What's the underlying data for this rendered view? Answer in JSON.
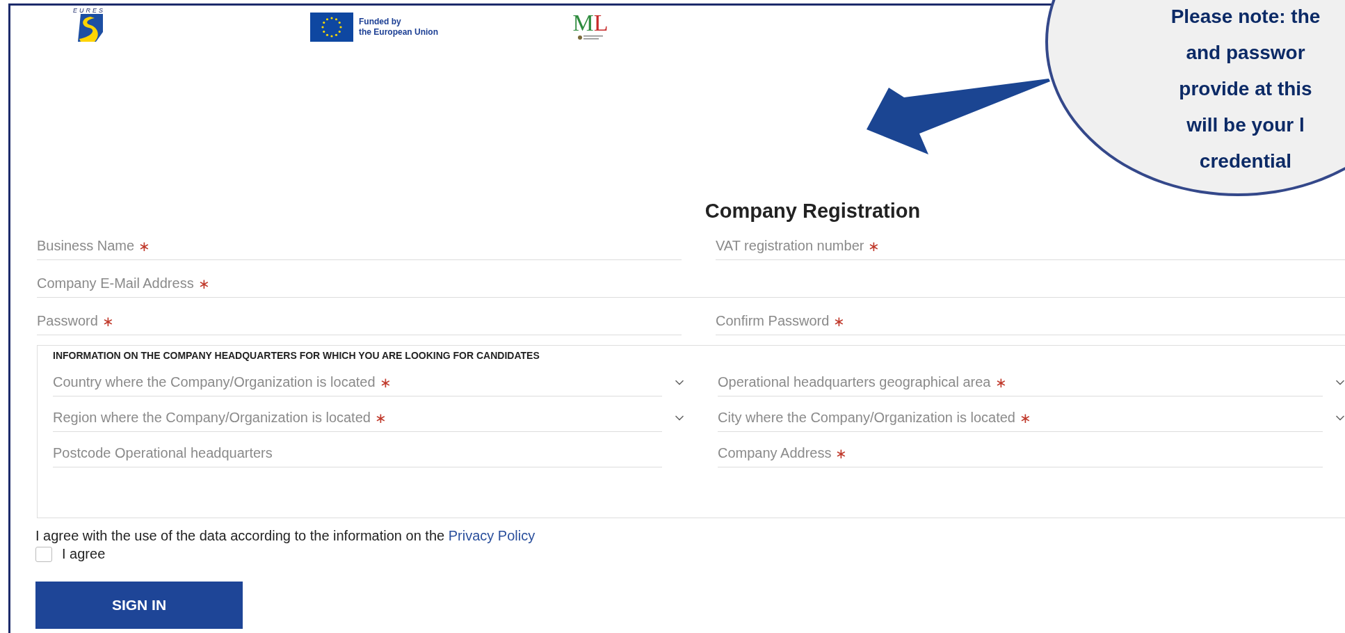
{
  "header": {
    "eures": {
      "wordmark": "EURES"
    },
    "funding": {
      "lines": [
        "Funded by",
        "the European Union"
      ]
    },
    "ministry": {
      "letters": [
        {
          "char": "M",
          "color": "#2e8b3e"
        },
        {
          "char": "L",
          "color": "#c62828"
        }
      ]
    }
  },
  "callout": {
    "lines": [
      "Please note: the",
      "and passwor",
      "provide at this",
      "will be your l",
      "credential"
    ]
  },
  "title": "Company Registration",
  "required_mark": "∗",
  "account_rows": [
    [
      {
        "label": "Business Name",
        "required": true
      },
      {
        "label": "VAT registration number",
        "required": true
      }
    ],
    [
      {
        "label": "Company E-Mail Address",
        "required": true
      }
    ],
    [
      {
        "label": "Password",
        "required": true
      },
      {
        "label": "Confirm Password",
        "required": true
      }
    ]
  ],
  "headquarters": {
    "legend": "INFORMATION ON THE COMPANY HEADQUARTERS FOR WHICH YOU ARE LOOKING FOR CANDIDATES",
    "rows": [
      [
        {
          "kind": "dropdown",
          "label": "Country where the Company/Organization is located",
          "required": true
        },
        {
          "kind": "dropdown",
          "label": "Operational headquarters geographical area",
          "required": true
        }
      ],
      [
        {
          "kind": "dropdown",
          "label": "Region where the Company/Organization is located",
          "required": true
        },
        {
          "kind": "dropdown",
          "label": "City where the Company/Organization is located",
          "required": true
        }
      ],
      [
        {
          "kind": "text",
          "label": "Postcode Operational headquarters",
          "required": false
        },
        {
          "kind": "text",
          "label": "Company Address",
          "required": true
        }
      ]
    ]
  },
  "consent": {
    "text": "I agree with the use of the data according to the information on the",
    "link": "Privacy Policy",
    "checkbox": {
      "label": "I agree",
      "checked": false
    }
  },
  "submit": "SIGN IN"
}
